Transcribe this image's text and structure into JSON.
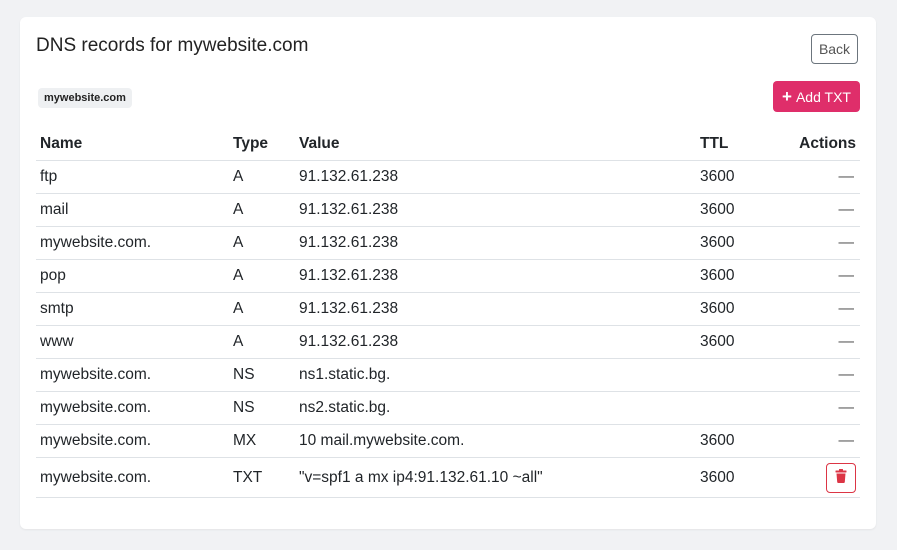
{
  "page": {
    "title": "DNS records for mywebsite.com",
    "back_label": "Back",
    "domain_badge": "mywebsite.com",
    "add_txt_label": "Add TXT",
    "add_icon": "plus-icon",
    "accent_color": "#df2e6a",
    "danger_color": "#dc3545"
  },
  "table": {
    "headers": [
      "Name",
      "Type",
      "Value",
      "TTL",
      "Actions"
    ],
    "rows": [
      {
        "name": "ftp",
        "type": "A",
        "value": "91.132.61.238",
        "ttl": "3600",
        "action": "—"
      },
      {
        "name": "mail",
        "type": "A",
        "value": "91.132.61.238",
        "ttl": "3600",
        "action": "—"
      },
      {
        "name": "mywebsite.com.",
        "type": "A",
        "value": "91.132.61.238",
        "ttl": "3600",
        "action": "—"
      },
      {
        "name": "pop",
        "type": "A",
        "value": "91.132.61.238",
        "ttl": "3600",
        "action": "—"
      },
      {
        "name": "smtp",
        "type": "A",
        "value": "91.132.61.238",
        "ttl": "3600",
        "action": "—"
      },
      {
        "name": "www",
        "type": "A",
        "value": "91.132.61.238",
        "ttl": "3600",
        "action": "—"
      },
      {
        "name": "mywebsite.com.",
        "type": "NS",
        "value": "ns1.static.bg.",
        "ttl": "",
        "action": "—"
      },
      {
        "name": "mywebsite.com.",
        "type": "NS",
        "value": "ns2.static.bg.",
        "ttl": "",
        "action": "—"
      },
      {
        "name": "mywebsite.com.",
        "type": "MX",
        "value": "10 mail.mywebsite.com.",
        "ttl": "3600",
        "action": "—"
      },
      {
        "name": "mywebsite.com.",
        "type": "TXT",
        "value": "\"v=spf1 a mx ip4:91.132.61.10 ~all\"",
        "ttl": "3600",
        "action": "delete",
        "action_icon": "trash-icon"
      }
    ]
  }
}
